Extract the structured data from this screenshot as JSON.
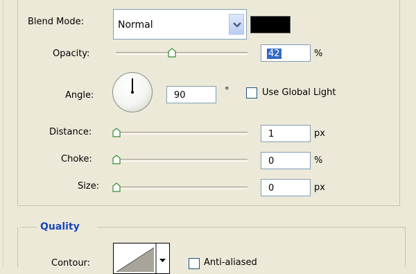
{
  "blend_mode": {
    "label": "Blend Mode:",
    "value": "Normal",
    "color": "#000000"
  },
  "opacity": {
    "label": "Opacity:",
    "value": "42",
    "unit": "%",
    "slider_fraction": 0.42
  },
  "angle": {
    "label": "Angle:",
    "value": "90",
    "unit": "°",
    "global_light_label": "Use Global Light",
    "global_light_checked": false
  },
  "distance": {
    "label": "Distance:",
    "value": "1",
    "unit": "px",
    "slider_fraction": 0.0
  },
  "choke": {
    "label": "Choke:",
    "value": "0",
    "unit": "%",
    "slider_fraction": 0.0
  },
  "size": {
    "label": "Size:",
    "value": "0",
    "unit": "px",
    "slider_fraction": 0.0
  },
  "quality": {
    "title": "Quality",
    "contour_label": "Contour:",
    "anti_aliased_label": "Anti-aliased",
    "anti_aliased_checked": false
  },
  "icons": [
    "chevron-down-icon",
    "slider-thumb-icon",
    "angle-dial-icon",
    "contour-preview-icon",
    "dropdown-arrow-icon"
  ]
}
